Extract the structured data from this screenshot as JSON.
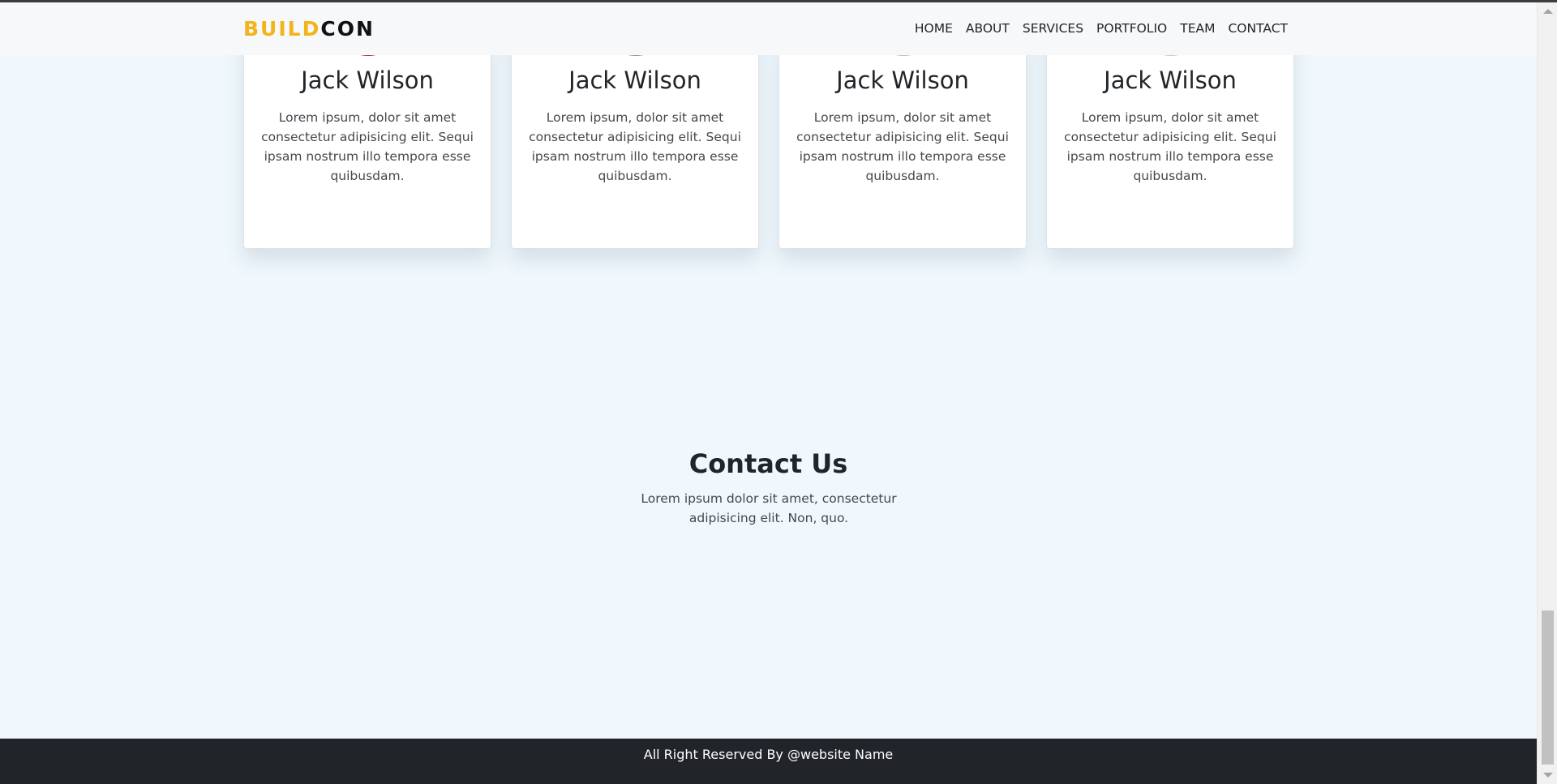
{
  "navbar": {
    "brand": {
      "part1": "BUILD",
      "part2": "CON"
    },
    "links": [
      "HOME",
      "ABOUT",
      "SERVICES",
      "PORTFOLIO",
      "TEAM",
      "CONTACT"
    ]
  },
  "team": {
    "cards": [
      {
        "name": "Jack Wilson",
        "description": "Lorem ipsum, dolor sit amet consectetur adipisicing elit. Sequi ipsam nostrum illo tempora esse quibusdam."
      },
      {
        "name": "Jack Wilson",
        "description": "Lorem ipsum, dolor sit amet consectetur adipisicing elit. Sequi ipsam nostrum illo tempora esse quibusdam."
      },
      {
        "name": "Jack Wilson",
        "description": "Lorem ipsum, dolor sit amet consectetur adipisicing elit. Sequi ipsam nostrum illo tempora esse quibusdam."
      },
      {
        "name": "Jack Wilson",
        "description": "Lorem ipsum, dolor sit amet consectetur adipisicing elit. Sequi ipsam nostrum illo tempora esse quibusdam."
      }
    ]
  },
  "contact": {
    "title": "Contact Us",
    "text": "Lorem ipsum dolor sit amet, consectetur adipisicing elit. Non, quo."
  },
  "footer": {
    "text": "All Right Reserved By @website Name"
  },
  "colors": {
    "brand_accent": "#f4b319",
    "footer_bg": "#212529",
    "page_bg": "#f0f8fd"
  }
}
